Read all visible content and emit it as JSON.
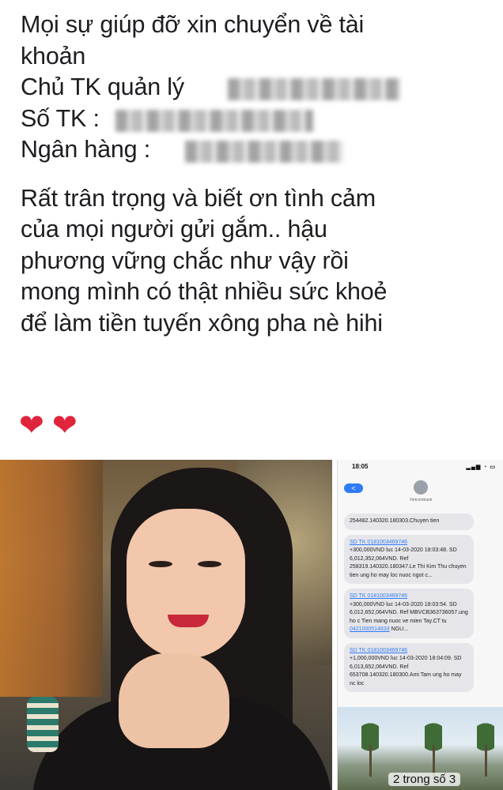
{
  "post": {
    "lines": [
      "Mọi sự giúp đỡ xin chuyển về tài",
      "khoản",
      "Chủ TK quản lý",
      "Số TK :",
      "Ngân hàng :",
      "Rất trân trọng và biết ơn tình cảm",
      "của mọi người gửi gắm.. hậu",
      "phương vững chắc như vậy rồi",
      "mong mình có thật nhiều sức khoẻ",
      "để làm tiền tuyến xông pha nè hihi"
    ],
    "hearts": [
      "❤",
      "❤"
    ]
  },
  "sms": {
    "time": "18:05",
    "back_label": "<",
    "sender": "Vietcombank",
    "messages": [
      {
        "text": "254482.140320.180303.Chuyen tien"
      },
      {
        "account": "SD TK 0181003469746",
        "text": "+300,000VND luc 14-03-2020 18:03:48. SD 6,012,352,064VND. Ref 258319.140320.180347.Le Thi Kim Thu chuyen tien ung ho may loc nuoc ngot c..."
      },
      {
        "account": "SD TK 0181003469746",
        "text": "+300,000VND luc 14-03-2020 18:03:54. SD 6,012,652,064VND. Ref MBVCB363736057.ung ho c Tien mang nuoc ve mien Tay.CT tu",
        "link2": "0421000514833",
        "tail": "NGU..."
      },
      {
        "account": "SD TK 0181003469746",
        "text": "+1,000,000VND luc 14-03-2020 18:04:09. SD 6,013,652,064VND. Ref 653708.140320.180300.Ami Tam ung ho may nc loc"
      }
    ]
  },
  "gallery": {
    "page_indicator": "2 trong số 3"
  }
}
